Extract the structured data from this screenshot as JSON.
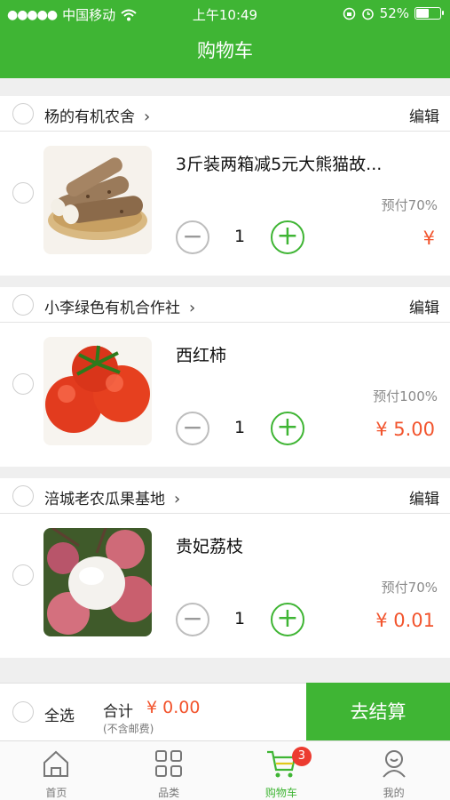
{
  "status": {
    "carrier": "中国移动",
    "time": "上午10:49",
    "battery": "52%",
    "battery_level": 0.52
  },
  "nav": {
    "title": "购物车"
  },
  "stores": [
    {
      "name": "杨的有机农舍",
      "edit": "编辑",
      "item": {
        "name": "3斤装两箱减5元大熊猫故...",
        "prepay": "预付70%",
        "qty": "1",
        "price": "¥",
        "image": "yam-image"
      }
    },
    {
      "name": "小李绿色有机合作社",
      "edit": "编辑",
      "item": {
        "name": "西红柿",
        "prepay": "预付100%",
        "qty": "1",
        "price": "¥ 5.00",
        "image": "tomato-image"
      }
    },
    {
      "name": "涪城老农瓜果基地",
      "edit": "编辑",
      "item": {
        "name": "贵妃荔枝",
        "prepay": "预付70%",
        "qty": "1",
        "price": "¥ 0.01",
        "image": "lychee-image"
      }
    }
  ],
  "checkout": {
    "select_all": "全选",
    "total_label": "合计",
    "total_value": "¥ 0.00",
    "shipping_note": "(不含邮费)",
    "pay_button": "去结算"
  },
  "tabs": [
    {
      "label": "首页",
      "icon": "home-icon"
    },
    {
      "label": "品类",
      "icon": "category-icon"
    },
    {
      "label": "购物车",
      "icon": "cart-icon",
      "badge": "3",
      "active": true
    },
    {
      "label": "我的",
      "icon": "profile-icon"
    }
  ],
  "colors": {
    "accent": "#3fb534",
    "price": "#f2542d",
    "badge": "#ec3b30"
  }
}
